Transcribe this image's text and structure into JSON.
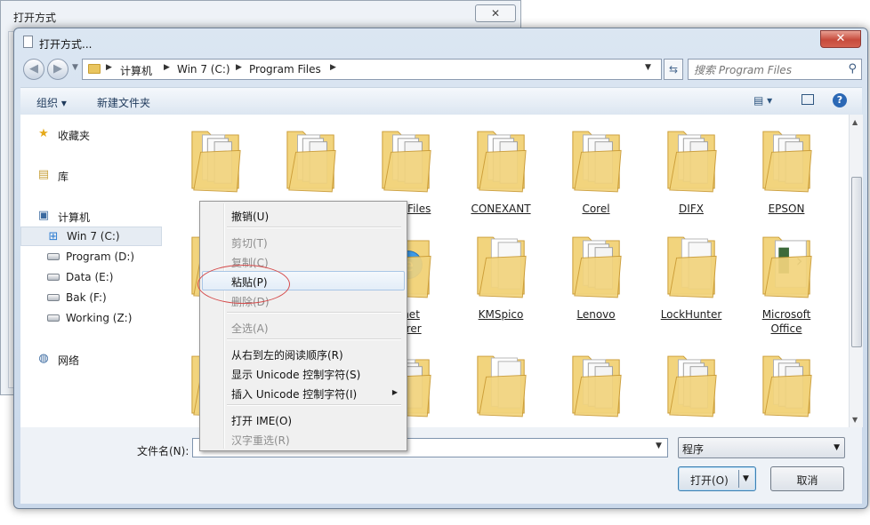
{
  "background_dialog": {
    "title": "打开方式",
    "close_glyph": "✕"
  },
  "dialog": {
    "title": "打开方式...",
    "close_glyph": "✕",
    "breadcrumb": [
      "计算机",
      "Win 7 (C:)",
      "Program Files"
    ],
    "search_placeholder": "搜索 Program Files",
    "toolbar": {
      "organize": "组织 ▾",
      "new_folder": "新建文件夹",
      "view_glyph": "▤ ▾",
      "help_glyph": "?"
    },
    "nav_pane": {
      "favorites": "收藏夹",
      "libraries": "库",
      "computer": "计算机",
      "drives": [
        "Win 7 (C:)",
        "Program (D:)",
        "Data (E:)",
        "Bak (F:)",
        "Working (Z:)"
      ],
      "network": "网络"
    },
    "folders": [
      {
        "label": "",
        "variant": "docs"
      },
      {
        "label": "",
        "variant": "docs"
      },
      {
        "label": "mon Files",
        "variant": "docs"
      },
      {
        "label": "CONEXANT",
        "variant": "docs"
      },
      {
        "label": "Corel",
        "variant": "docs"
      },
      {
        "label": "DIFX",
        "variant": "docs"
      },
      {
        "label": "EPSON",
        "variant": "docs"
      },
      {
        "label": "ICB",
        "variant": "docs"
      },
      {
        "label": "",
        "variant": "plain"
      },
      {
        "label": "ernet\nplorer",
        "variant": "ie"
      },
      {
        "label": "KMSpico",
        "variant": "pages"
      },
      {
        "label": "Lenovo",
        "variant": "docs"
      },
      {
        "label": "LockHunter",
        "variant": "pages"
      },
      {
        "label": "Microsoft\nOffice",
        "variant": "office"
      },
      {
        "label": "",
        "variant": "plain"
      },
      {
        "label": "",
        "variant": "plain"
      },
      {
        "label": "",
        "variant": "docs"
      },
      {
        "label": "",
        "variant": "pages"
      },
      {
        "label": "",
        "variant": "docs"
      },
      {
        "label": "",
        "variant": "docs"
      },
      {
        "label": "",
        "variant": "docs"
      }
    ],
    "filename_label": "文件名(N):",
    "filename_value": "",
    "file_type": "程序",
    "open_button": "打开(O)",
    "cancel_button": "取消"
  },
  "context_menu": {
    "items": [
      {
        "label": "撤销(U)",
        "disabled": false
      },
      {
        "label": "剪切(T)",
        "disabled": true
      },
      {
        "label": "复制(C)",
        "disabled": true
      },
      {
        "label": "粘贴(P)",
        "disabled": false,
        "highlighted": true
      },
      {
        "label": "删除(D)",
        "disabled": true
      },
      {
        "label": "全选(A)",
        "disabled": true
      },
      {
        "label": "从右到左的阅读顺序(R)",
        "disabled": false
      },
      {
        "label": "显示 Unicode 控制字符(S)",
        "disabled": false
      },
      {
        "label": "插入 Unicode 控制字符(I)",
        "disabled": false,
        "submenu": true
      },
      {
        "label": "打开 IME(O)",
        "disabled": false
      },
      {
        "label": "汉字重选(R)",
        "disabled": true
      }
    ],
    "submenu_glyph": "▶"
  },
  "colors": {
    "folder_fill": "#f2d47d",
    "folder_edge": "#c99a34",
    "highlight_ring": "#d54b4b"
  }
}
